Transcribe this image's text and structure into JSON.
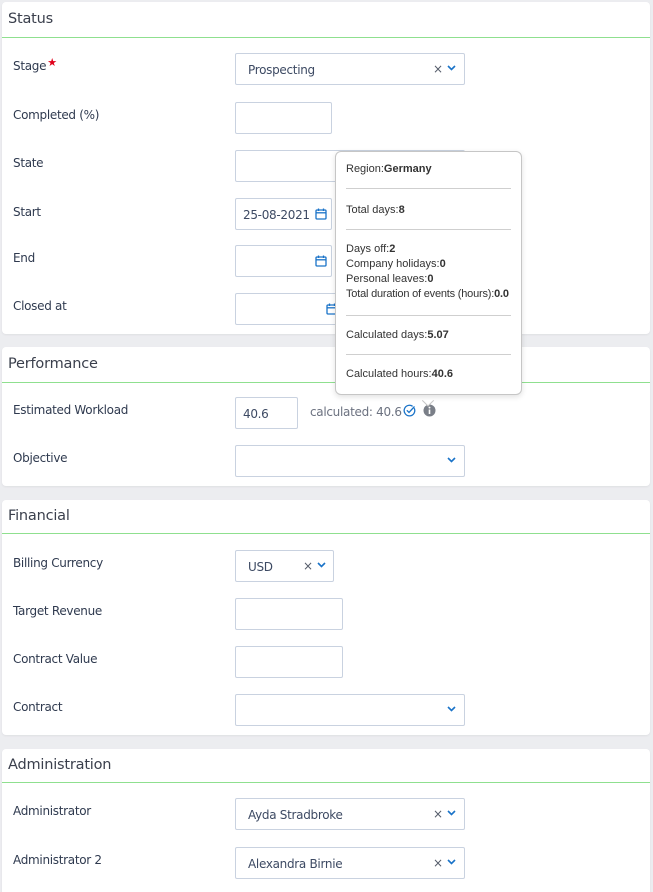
{
  "sections": {
    "status": {
      "title": "Status",
      "stage": {
        "label": "Stage",
        "required_mark": "★",
        "value": "Prospecting"
      },
      "completed": {
        "label": "Completed (%)",
        "value": ""
      },
      "state": {
        "label": "State",
        "value": ""
      },
      "start": {
        "label": "Start",
        "value": "25-08-2021"
      },
      "end": {
        "label": "End",
        "value": ""
      },
      "closed_at": {
        "label": "Closed at",
        "value": ""
      }
    },
    "performance": {
      "title": "Performance",
      "estimated_workload": {
        "label": "Estimated Workload",
        "value": "40.6",
        "calculated_text": "calculated: 40.6"
      },
      "objective": {
        "label": "Objective",
        "value": ""
      }
    },
    "financial": {
      "title": "Financial",
      "billing_currency": {
        "label": "Billing Currency",
        "value": "USD"
      },
      "target_revenue": {
        "label": "Target Revenue",
        "value": ""
      },
      "contract_value": {
        "label": "Contract Value",
        "value": ""
      },
      "contract": {
        "label": "Contract",
        "value": ""
      }
    },
    "administration": {
      "title": "Administration",
      "administrator": {
        "label": "Administrator",
        "value": "Ayda Stradbroke"
      },
      "administrator_2": {
        "label": "Administrator 2",
        "value": "Alexandra Birnie"
      }
    }
  },
  "tooltip": {
    "region_label": "Region:",
    "region_value": "Germany",
    "total_days_label": "Total days:",
    "total_days_value": "8",
    "days_off_label": "Days off:",
    "days_off_value": "2",
    "company_holidays_label": "Company holidays:",
    "company_holidays_value": "0",
    "personal_leaves_label": "Personal leaves:",
    "personal_leaves_value": "0",
    "events_duration_label": "Total duration of events (hours):",
    "events_duration_value": "0.0",
    "calc_days_label": "Calculated days:",
    "calc_days_value": "5.07",
    "calc_hours_label": "Calculated hours:",
    "calc_hours_value": "40.6"
  },
  "icons": {
    "clear": "×",
    "dropdown": "chevron-down-icon",
    "calendar": "calendar-icon",
    "check": "check-circle-icon",
    "info": "info-circle-icon"
  },
  "colors": {
    "accent": "#1a73c8",
    "section_rule": "#8fe08f",
    "required": "#e0001a"
  }
}
